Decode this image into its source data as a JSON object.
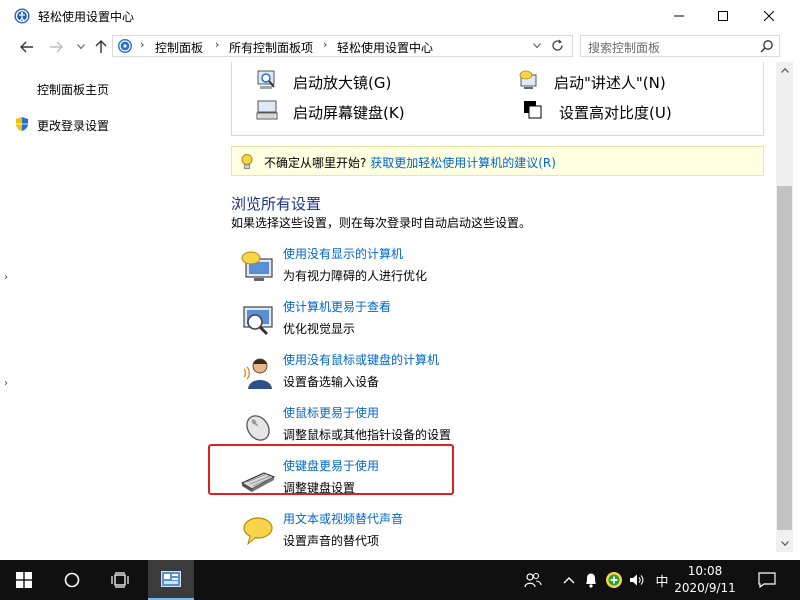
{
  "window": {
    "title": "轻松使用设置中心"
  },
  "address": {
    "crumbs": [
      "控制面板",
      "所有控制面板项",
      "轻松使用设置中心"
    ],
    "search_placeholder": "搜索控制面板"
  },
  "sidebar": {
    "home_link": "控制面板主页",
    "login_settings_link": "更改登录设置"
  },
  "quick_access": {
    "magnifier": "启动放大镜(G)",
    "narrator": "启动\"讲述人\"(N)",
    "onscreen_keyboard": "启动屏幕键盘(K)",
    "high_contrast": "设置高对比度(U)"
  },
  "tip": {
    "text": "不确定从哪里开始?",
    "link": "获取更加轻松使用计算机的建议(R)"
  },
  "browse": {
    "heading": "浏览所有设置",
    "description": "如果选择这些设置，则在每次登录时自动启动这些设置。",
    "items": [
      {
        "link": "使用没有显示的计算机",
        "desc": "为有视力障碍的人进行优化",
        "icon": "speech-monitor-icon"
      },
      {
        "link": "使计算机更易于查看",
        "desc": "优化视觉显示",
        "icon": "magnifier-monitor-icon"
      },
      {
        "link": "使用没有鼠标或键盘的计算机",
        "desc": "设置备选输入设备",
        "icon": "person-speaking-icon"
      },
      {
        "link": "使鼠标更易于使用",
        "desc": "调整鼠标或其他指针设备的设置",
        "icon": "mouse-icon"
      },
      {
        "link": "使键盘更易于使用",
        "desc": "调整键盘设置",
        "icon": "keyboard-icon"
      },
      {
        "link": "用文本或视频替代声音",
        "desc": "设置声音的替代项",
        "icon": "speech-bubble-icon"
      }
    ]
  },
  "taskbar": {
    "ime": "中",
    "time": "10:08",
    "date": "2020/9/11"
  },
  "colors": {
    "link": "#0066cc",
    "heading": "#1e3287",
    "tip_background": "#ffffe1",
    "highlight": "#e02020",
    "taskbar": "#101010"
  }
}
